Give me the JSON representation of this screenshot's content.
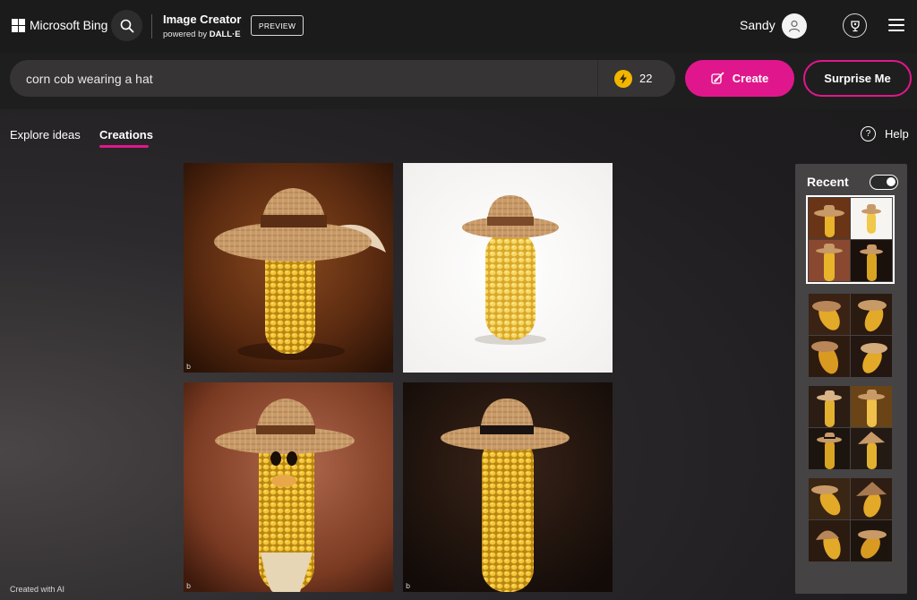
{
  "header": {
    "brand": "Microsoft Bing",
    "product_title": "Image Creator",
    "powered_by_prefix": "powered by",
    "powered_by_name": "DALL·E",
    "badge": "PREVIEW",
    "user_name": "Sandy"
  },
  "prompt": {
    "value": "corn cob wearing a hat",
    "boosts": "22",
    "create_label": "Create",
    "surprise_label": "Surprise Me"
  },
  "tabs": {
    "explore": "Explore ideas",
    "creations": "Creations",
    "active": "Creations"
  },
  "help_label": "Help",
  "recent": {
    "title": "Recent",
    "toggle_on": true
  },
  "footer_note": "Created with AI",
  "colors": {
    "accent": "#e0178c",
    "boost_coin": "#f2b600",
    "topbar": "#1c1b1b",
    "panel": "#454344"
  },
  "icons": {
    "search": "search-icon",
    "avatar": "user-icon",
    "rewards": "trophy-icon",
    "menu": "hamburger-icon",
    "boost": "lightning-coin-icon",
    "create": "brush-icon",
    "help": "question-circle-icon"
  }
}
